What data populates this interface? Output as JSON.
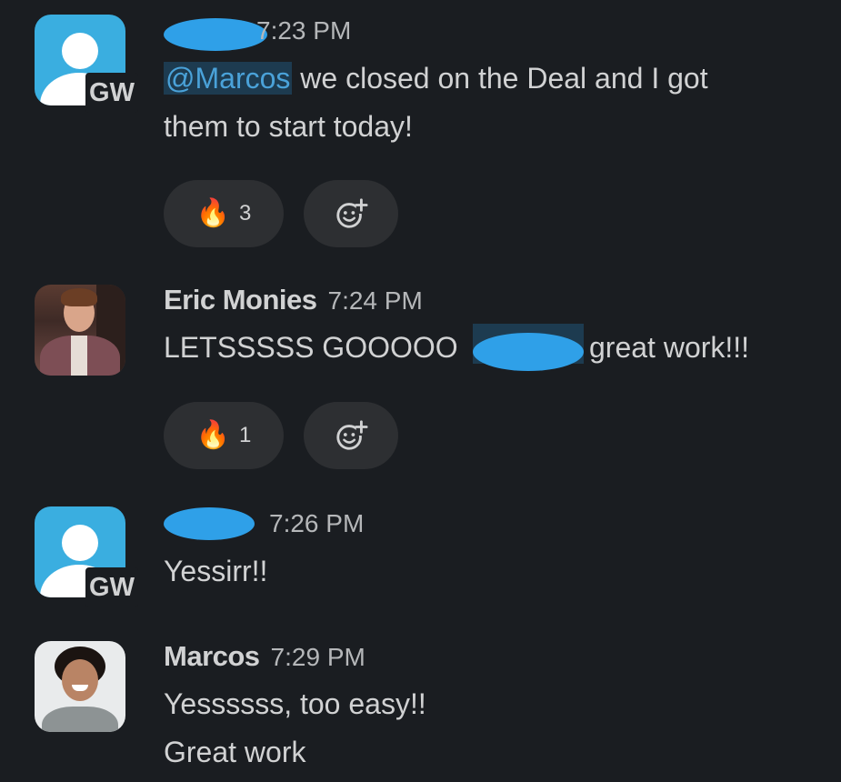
{
  "messages": [
    {
      "avatar_icon": "user-placeholder-icon",
      "avatar_badge": "GW",
      "name": "",
      "time": "7:23 PM",
      "mention": "@Marcos",
      "text_line1": " we closed on the Deal and I got",
      "text_line2": "them to start today!",
      "reaction": {
        "emoji": "🔥",
        "count": "3"
      }
    },
    {
      "name": "Eric Monies",
      "time": "7:24 PM",
      "text_before": "LETSSSSS GOOOOO ",
      "text_after": "great work!!!",
      "reaction": {
        "emoji": "🔥",
        "count": "1"
      }
    },
    {
      "avatar_icon": "user-placeholder-icon",
      "avatar_badge": "GW",
      "name": "",
      "time": "7:26 PM",
      "text_line1": "Yessirr!!"
    },
    {
      "name": "Marcos",
      "time": "7:29 PM",
      "text_line1": "Yessssss, too easy!!",
      "text_line2": "Great work"
    }
  ],
  "colors": {
    "background": "#1a1d21",
    "mention_bg": "#1d3b50",
    "mention_text": "#4aa2d9",
    "pill": "#2d2f32",
    "redaction": "#2fa0e8",
    "gw_avatar": "#3aaee0"
  }
}
